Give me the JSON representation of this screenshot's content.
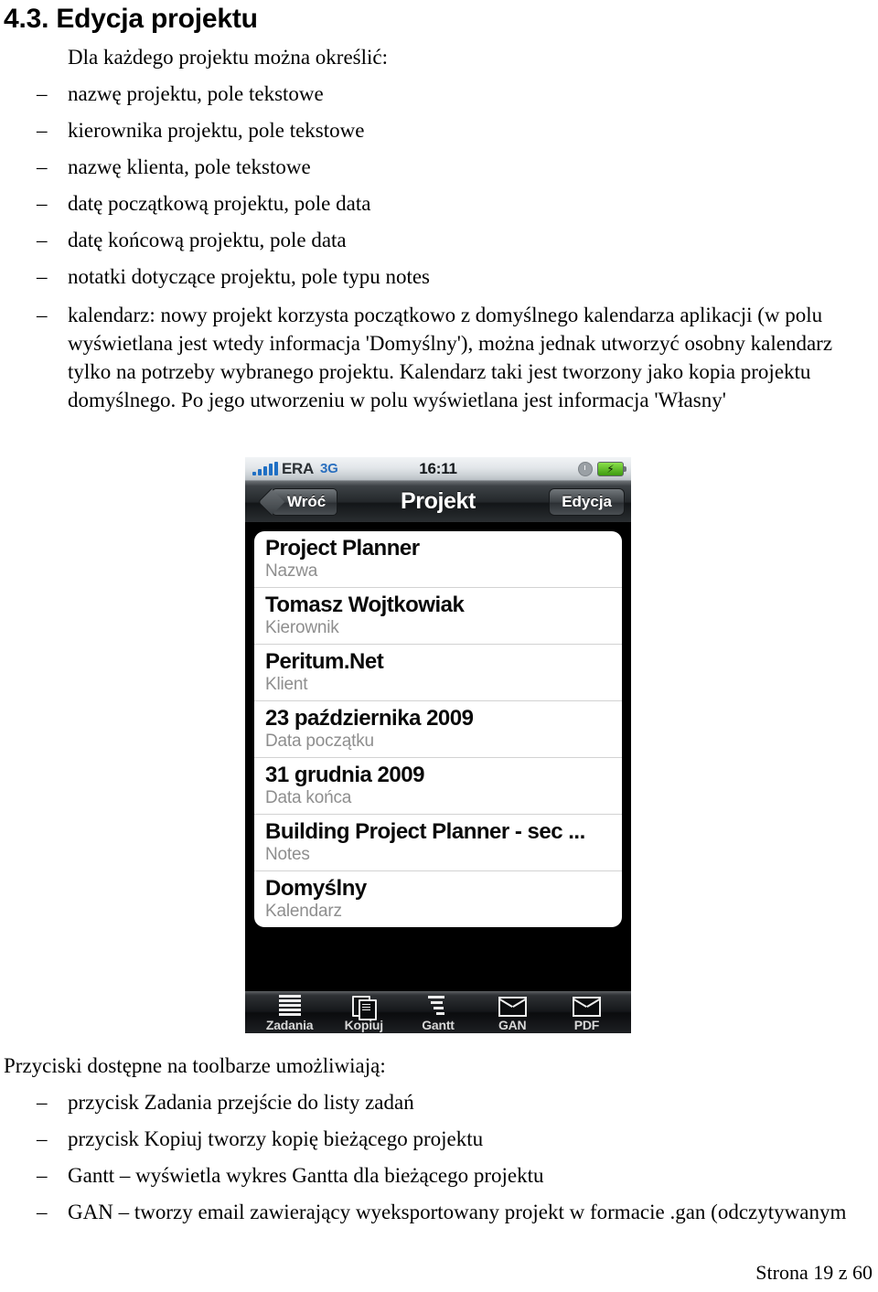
{
  "document": {
    "heading": "4.3. Edycja projektu",
    "intro": "Dla każdego projektu można określić:",
    "bullets": [
      "nazwę projektu, pole tekstowe",
      "kierownika projektu, pole tekstowe",
      "nazwę klienta, pole tekstowe",
      "datę początkową projektu, pole data",
      "datę końcową projektu, pole data",
      "notatki dotyczące projektu, pole typu notes",
      "kalendarz: nowy projekt korzysta początkowo z domyślnego kalendarza aplikacji (w polu wyświetlana jest wtedy informacja 'Domyślny'), można jednak utworzyć osobny kalendarz tylko na potrzeby wybranego projektu. Kalendarz taki jest tworzony jako kopia projektu domyślnego. Po jego utworzeniu w polu wyświetlana jest informacja 'Własny'"
    ],
    "toolbar_lead": "Przyciski dostępne na toolbarze umożliwiają:",
    "toolbar_bullets": [
      "przycisk Zadania przejście do listy zadań",
      "przycisk Kopiuj tworzy kopię bieżącego projektu",
      "Gantt – wyświetla wykres Gantta dla bieżącego projektu",
      "GAN – tworzy email zawierający wyeksportowany projekt w formacie .gan (odczytywanym"
    ],
    "page_footer": "Strona 19 z 60",
    "dash": "–"
  },
  "phone": {
    "status_bar": {
      "carrier": "ERA",
      "network": "3G",
      "time": "16:11",
      "signal_icon": "signal-bars-icon",
      "alarm_icon": "alarm-clock-icon",
      "battery_icon": "battery-charging-icon",
      "bolt_glyph": "⚡"
    },
    "nav_bar": {
      "back_label": "Wróć",
      "title": "Projekt",
      "edit_label": "Edycja"
    },
    "rows": [
      {
        "value": "Project Planner",
        "label": "Nazwa"
      },
      {
        "value": "Tomasz Wojtkowiak",
        "label": "Kierownik"
      },
      {
        "value": "Peritum.Net",
        "label": "Klient"
      },
      {
        "value": "23 października 2009",
        "label": "Data początku"
      },
      {
        "value": "31 grudnia 2009",
        "label": "Data końca"
      },
      {
        "value": "Building Project Planner - sec ...",
        "label": "Notes"
      },
      {
        "value": "Domyślny",
        "label": "Kalendarz"
      }
    ],
    "toolbar": [
      {
        "label": "Zadania",
        "icon": "list-lines-icon"
      },
      {
        "label": "Kopiuj",
        "icon": "copy-pages-icon"
      },
      {
        "label": "Gantt",
        "icon": "gantt-bars-icon"
      },
      {
        "label": "GAN",
        "icon": "envelope-icon"
      },
      {
        "label": "PDF",
        "icon": "envelope-icon"
      }
    ]
  },
  "colors": {
    "accent_blue": "#2a6fbe",
    "battery_green": "#3e9b10",
    "label_gray": "#8e8e8e"
  }
}
